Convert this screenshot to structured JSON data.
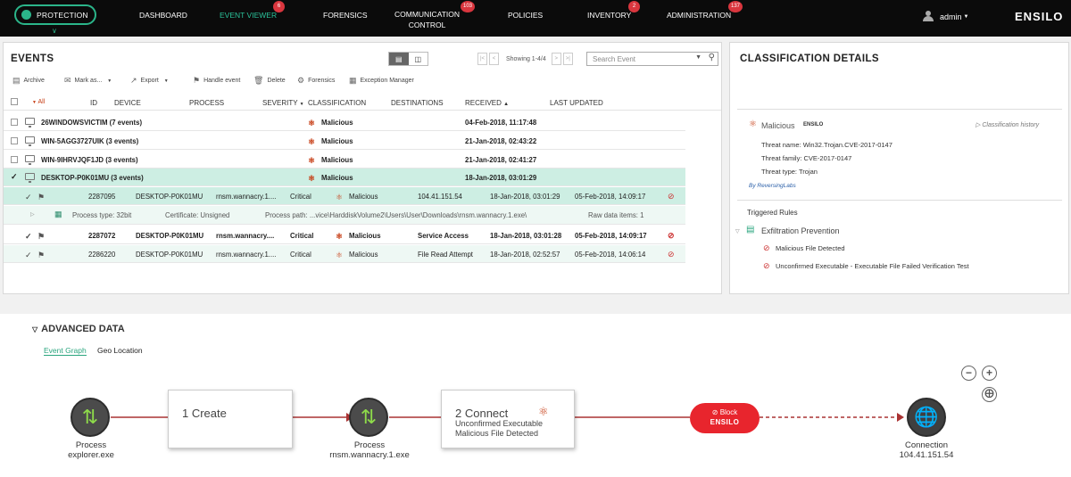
{
  "topnav": {
    "protection": "PROTECTION",
    "items": [
      {
        "label": "DASHBOARD"
      },
      {
        "label": "EVENT VIEWER",
        "badge": "6"
      },
      {
        "label": "FORENSICS"
      },
      {
        "label": "COMMUNICATION\nCONTROL",
        "badge": "103"
      },
      {
        "label": "POLICIES"
      },
      {
        "label": "INVENTORY",
        "badge": "2"
      },
      {
        "label": "ADMINISTRATION",
        "badge": "137"
      }
    ],
    "user": "admin",
    "logo": "ENSILO"
  },
  "events": {
    "title": "EVENTS",
    "showing": "Showing 1-4/4",
    "search_placeholder": "Search Event",
    "toolbar": [
      "Archive",
      "Mark as...",
      "Export",
      "Handle event",
      "Delete",
      "Forensics",
      "Exception Manager"
    ],
    "headers": {
      "all": "All",
      "id": "ID",
      "device": "DEVICE",
      "process": "PROCESS",
      "severity": "SEVERITY",
      "classification": "CLASSIFICATION",
      "destinations": "DESTINATIONS",
      "received": "RECEIVED",
      "last_updated": "LAST UPDATED"
    },
    "groups": [
      {
        "name": "26WINDOWSVICTIM (7 events)",
        "classification": "Malicious",
        "received": "04-Feb-2018, 11:17:48"
      },
      {
        "name": "WIN-5AGG3727UIK (3 events)",
        "classification": "Malicious",
        "received": "21-Jan-2018, 02:43:22"
      },
      {
        "name": "WIN-9IHRVJQF1JD (3 events)",
        "classification": "Malicious",
        "received": "21-Jan-2018, 02:41:27"
      },
      {
        "name": "DESKTOP-P0K01MU (3 events)",
        "classification": "Malicious",
        "received": "18-Jan-2018, 03:01:29"
      }
    ],
    "rows": [
      {
        "id": "2287095",
        "device": "DESKTOP-P0K01MU",
        "process": "rnsm.wannacry.1....",
        "severity": "Critical",
        "classification": "Malicious",
        "destination": "104.41.151.54",
        "received": "18-Jan-2018, 03:01:29",
        "updated": "05-Feb-2018, 14:09:17"
      },
      {
        "id": "2287072",
        "device": "DESKTOP-P0K01MU",
        "process": "rnsm.wannacry....",
        "severity": "Critical",
        "classification": "Malicious",
        "destination": "Service Access",
        "received": "18-Jan-2018, 03:01:28",
        "updated": "05-Feb-2018, 14:09:17"
      },
      {
        "id": "2286220",
        "device": "DESKTOP-P0K01MU",
        "process": "rnsm.wannacry.1....",
        "severity": "Critical",
        "classification": "Malicious",
        "destination": "File Read Attempt",
        "received": "18-Jan-2018, 02:52:57",
        "updated": "05-Feb-2018, 14:06:14"
      }
    ],
    "detail": {
      "process_type": "Process type: 32bit",
      "certificate": "Certificate: Unsigned",
      "process_path": "Process path:  ...vice\\HarddiskVolume2\\Users\\User\\Downloads\\rnsm.wannacry.1.exe\\",
      "raw": "Raw data items: 1"
    }
  },
  "classification": {
    "title": "CLASSIFICATION DETAILS",
    "verdict": "Malicious",
    "vendor": "ENSILO",
    "history": "Classification history",
    "threat_name": "Threat name: Win32.Trojan.CVE-2017-0147",
    "threat_family": "Threat family: CVE-2017-0147",
    "threat_type": "Threat type: Trojan",
    "by": "By ReversingLabs",
    "rules_title": "Triggered Rules",
    "rule_group": "Exfiltration Prevention",
    "rules": [
      "Malicious File Detected",
      "Unconfirmed Executable - Executable File Failed Verification Test"
    ]
  },
  "advanced": {
    "title": "ADVANCED DATA",
    "tabs": [
      "Event Graph",
      "Geo Location"
    ],
    "nodes": [
      {
        "type": "Process",
        "name": "explorer.exe"
      },
      {
        "type": "Process",
        "name": "rnsm.wannacry.1.exe"
      },
      {
        "type": "Connection",
        "name": "104.41.151.54"
      }
    ],
    "step1": "1 Create",
    "step2": "2 Connect",
    "step2_sub1": "Unconfirmed Executable",
    "step2_sub2": "Malicious File Detected",
    "block": "Block",
    "block_logo": "ENSILO"
  },
  "colors": {
    "accent": "#2bc29a",
    "selected_row": "#cdeee3",
    "malicious": "#c63b12",
    "block": "#e8252d",
    "badge": "#d9363e"
  }
}
